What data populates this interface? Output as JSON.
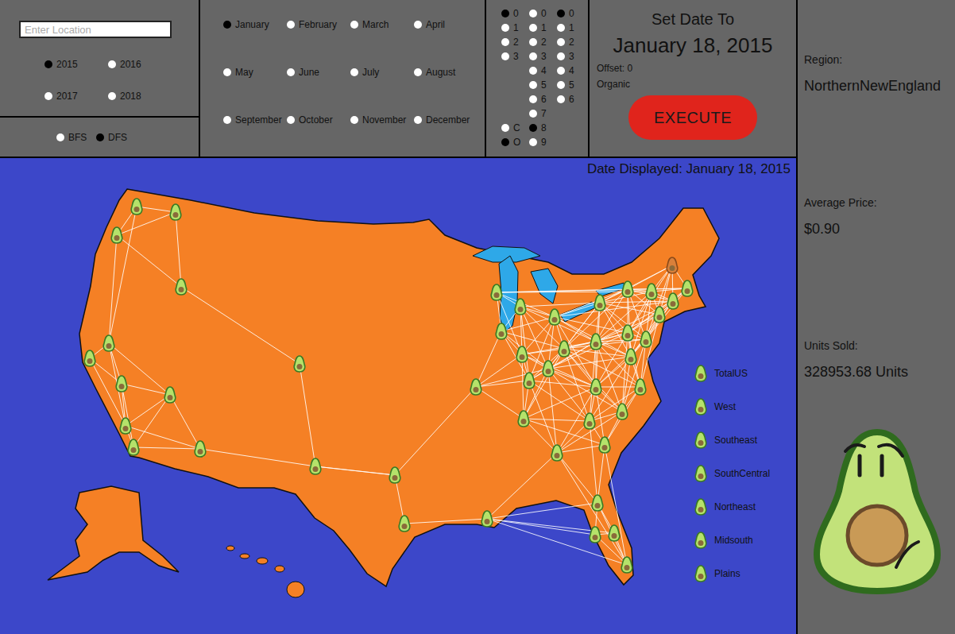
{
  "location": {
    "placeholder": "Enter Location",
    "value": ""
  },
  "years": [
    {
      "label": "2015",
      "selected": true
    },
    {
      "label": "2016",
      "selected": false
    },
    {
      "label": "2017",
      "selected": false
    },
    {
      "label": "2018",
      "selected": false
    }
  ],
  "search_modes": [
    {
      "label": "BFS",
      "selected": false
    },
    {
      "label": "DFS",
      "selected": true
    }
  ],
  "months": [
    {
      "label": "January",
      "selected": true
    },
    {
      "label": "February",
      "selected": false
    },
    {
      "label": "March",
      "selected": false
    },
    {
      "label": "April",
      "selected": false
    },
    {
      "label": "May",
      "selected": false
    },
    {
      "label": "June",
      "selected": false
    },
    {
      "label": "July",
      "selected": false
    },
    {
      "label": "August",
      "selected": false
    },
    {
      "label": "September",
      "selected": false
    },
    {
      "label": "October",
      "selected": false
    },
    {
      "label": "November",
      "selected": false
    },
    {
      "label": "December",
      "selected": false
    }
  ],
  "day_tens": [
    {
      "label": "0",
      "selected": true
    },
    {
      "label": "1",
      "selected": false
    },
    {
      "label": "2",
      "selected": false
    },
    {
      "label": "3",
      "selected": false
    }
  ],
  "avocado_type": [
    {
      "label": "C",
      "selected": false
    },
    {
      "label": "O",
      "selected": true
    }
  ],
  "day_ones": [
    {
      "label": "0",
      "selected": false
    },
    {
      "label": "1",
      "selected": false
    },
    {
      "label": "2",
      "selected": false
    },
    {
      "label": "3",
      "selected": false
    },
    {
      "label": "4",
      "selected": false
    },
    {
      "label": "5",
      "selected": false
    },
    {
      "label": "6",
      "selected": false
    },
    {
      "label": "7",
      "selected": false
    },
    {
      "label": "8",
      "selected": true
    },
    {
      "label": "9",
      "selected": false
    }
  ],
  "offset_digits": [
    {
      "label": "0",
      "selected": true
    },
    {
      "label": "1",
      "selected": false
    },
    {
      "label": "2",
      "selected": false
    },
    {
      "label": "3",
      "selected": false
    },
    {
      "label": "4",
      "selected": false
    },
    {
      "label": "5",
      "selected": false
    },
    {
      "label": "6",
      "selected": false
    }
  ],
  "set_date": {
    "heading": "Set Date To",
    "date": "January 18, 2015",
    "offset": "Offset: 0",
    "type": "Organic",
    "button": "EXECUTE"
  },
  "map": {
    "date_displayed": "Date Displayed: January 18, 2015",
    "pins": [
      {
        "selected": false
      },
      {
        "selected": false
      },
      {
        "selected": false
      },
      {
        "selected": false
      },
      {
        "selected": false
      },
      {
        "selected": false
      },
      {
        "selected": false
      },
      {
        "selected": false
      },
      {
        "selected": false
      },
      {
        "selected": false
      },
      {
        "selected": false
      },
      {
        "selected": false
      },
      {
        "selected": false
      },
      {
        "selected": false
      },
      {
        "selected": false
      },
      {
        "selected": false
      },
      {
        "selected": false
      },
      {
        "selected": false
      },
      {
        "selected": false
      },
      {
        "selected": false
      },
      {
        "selected": false
      },
      {
        "selected": false
      },
      {
        "selected": false
      },
      {
        "selected": false
      },
      {
        "selected": false
      },
      {
        "selected": false
      },
      {
        "selected": false
      },
      {
        "selected": false
      },
      {
        "selected": false
      },
      {
        "selected": true
      },
      {
        "selected": false
      },
      {
        "selected": false
      },
      {
        "selected": false
      },
      {
        "selected": false
      },
      {
        "selected": false
      },
      {
        "selected": false
      },
      {
        "selected": false
      },
      {
        "selected": false
      },
      {
        "selected": false
      },
      {
        "selected": false
      },
      {
        "selected": false
      },
      {
        "selected": false
      },
      {
        "selected": false
      },
      {
        "selected": false
      },
      {
        "selected": false
      },
      {
        "selected": false
      },
      {
        "selected": false
      }
    ]
  },
  "legend": [
    "TotalUS",
    "West",
    "Southeast",
    "SouthCentral",
    "Northeast",
    "Midsouth",
    "Plains"
  ],
  "details": {
    "region_label": "Region:",
    "region": "NorthernNewEngland",
    "price_label": "Average Price:",
    "price": "$0.90",
    "units_label": "Units Sold:",
    "units": "328953.68 Units"
  }
}
